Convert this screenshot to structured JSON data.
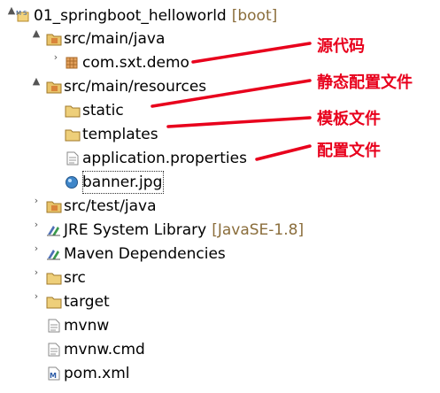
{
  "project": {
    "name": "01_springboot_helloworld",
    "decoration": "[boot]"
  },
  "items": [
    {
      "label": "src/main/java"
    },
    {
      "label": "com.sxt.demo"
    },
    {
      "label": "src/main/resources"
    },
    {
      "label": "static"
    },
    {
      "label": "templates"
    },
    {
      "label": "application.properties"
    },
    {
      "label": "banner.jpg"
    },
    {
      "label": "src/test/java"
    },
    {
      "label": "JRE System Library",
      "decoration": "[JavaSE-1.8]"
    },
    {
      "label": "Maven Dependencies"
    },
    {
      "label": "src"
    },
    {
      "label": "target"
    },
    {
      "label": "mvnw"
    },
    {
      "label": "mvnw.cmd"
    },
    {
      "label": "pom.xml"
    }
  ],
  "annotations": [
    {
      "text": "源代码"
    },
    {
      "text": "静态配置文件"
    },
    {
      "text": "模板文件"
    },
    {
      "text": "配置文件"
    }
  ],
  "colors": {
    "annotation": "#e8001c",
    "decoration": "#8a6d3b"
  }
}
